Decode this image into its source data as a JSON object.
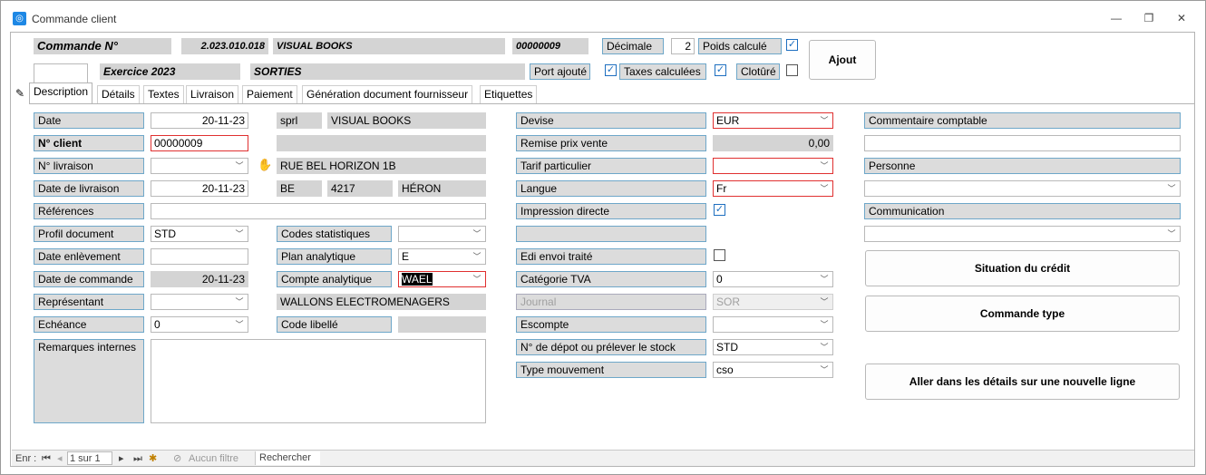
{
  "window": {
    "title": "Commande client"
  },
  "header": {
    "commande_label": "Commande N°",
    "commande_number": "2.023.010.018",
    "client_name": "VISUAL BOOKS",
    "client_code": "00000009",
    "decimale_label": "Décimale",
    "decimale_value": "2",
    "poids_label": "Poids calculé",
    "exercice": "Exercice 2023",
    "sorties": "SORTIES",
    "port_label": "Port ajouté",
    "taxes_label": "Taxes calculées",
    "cloture_label": "Clotûré",
    "ajout_button": "Ajout"
  },
  "tabs": [
    "Description",
    "Détails",
    "Textes",
    "Livraison",
    "Paiement",
    "Génération document fournisseur",
    "Etiquettes"
  ],
  "col1": {
    "date_label": "Date",
    "date_value": "20-11-23",
    "client_label": "N° client",
    "client_value": "00000009",
    "livraison_label": "N° livraison",
    "date_livraison_label": "Date de livraison",
    "date_livraison_value": "20-11-23",
    "references_label": "Références",
    "profil_label": "Profil document",
    "profil_value": "STD",
    "enlevement_label": "Date enlèvement",
    "commande_label": "Date de commande",
    "commande_value": "20-11-23",
    "representant_label": "Représentant",
    "echeance_label": "Echéance",
    "echeance_value": "0",
    "remarques_label": "Remarques internes"
  },
  "col2": {
    "forme": "sprl",
    "nom": "VISUAL BOOKS",
    "adresse": "RUE BEL HORIZON 1B",
    "pays": "BE",
    "cp": "4217",
    "ville": "HÉRON",
    "codes_stat_label": "Codes statistiques",
    "plan_label": "Plan analytique",
    "plan_value": "E",
    "compte_label": "Compte analytique",
    "compte_value": "WAEL",
    "representant_name": "WALLONS ELECTROMENAGERS",
    "code_libelle_label": "Code libellé"
  },
  "col3": {
    "devise_label": "Devise",
    "devise_value": "EUR",
    "remise_label": "Remise prix vente",
    "remise_value": "0,00",
    "tarif_label": "Tarif particulier",
    "langue_label": "Langue",
    "langue_value": "Fr",
    "impression_label": "Impression directe",
    "edi_label": "Edi envoi traité",
    "tva_label": "Catégorie TVA",
    "tva_value": "0",
    "journal_label": "Journal",
    "journal_value": "SOR",
    "escompte_label": "Escompte",
    "depot_label": "N° de dépot ou prélever le stock",
    "depot_value": "STD",
    "mouvement_label": "Type mouvement",
    "mouvement_value": "cso"
  },
  "col4": {
    "commentaire_label": "Commentaire comptable",
    "personne_label": "Personne",
    "communication_label": "Communication",
    "credit_button": "Situation du crédit",
    "commande_type_button": "Commande type",
    "nouvelle_ligne_button": "Aller dans les détails sur une nouvelle ligne"
  },
  "statusbar": {
    "enr_label": "Enr :",
    "record": "1 sur 1",
    "filter": "Aucun filtre",
    "search": "Rechercher"
  },
  "colors": {
    "accent_border": "#6ea7c9",
    "error_border": "#e03030",
    "field_gray": "#d4d4d4"
  }
}
